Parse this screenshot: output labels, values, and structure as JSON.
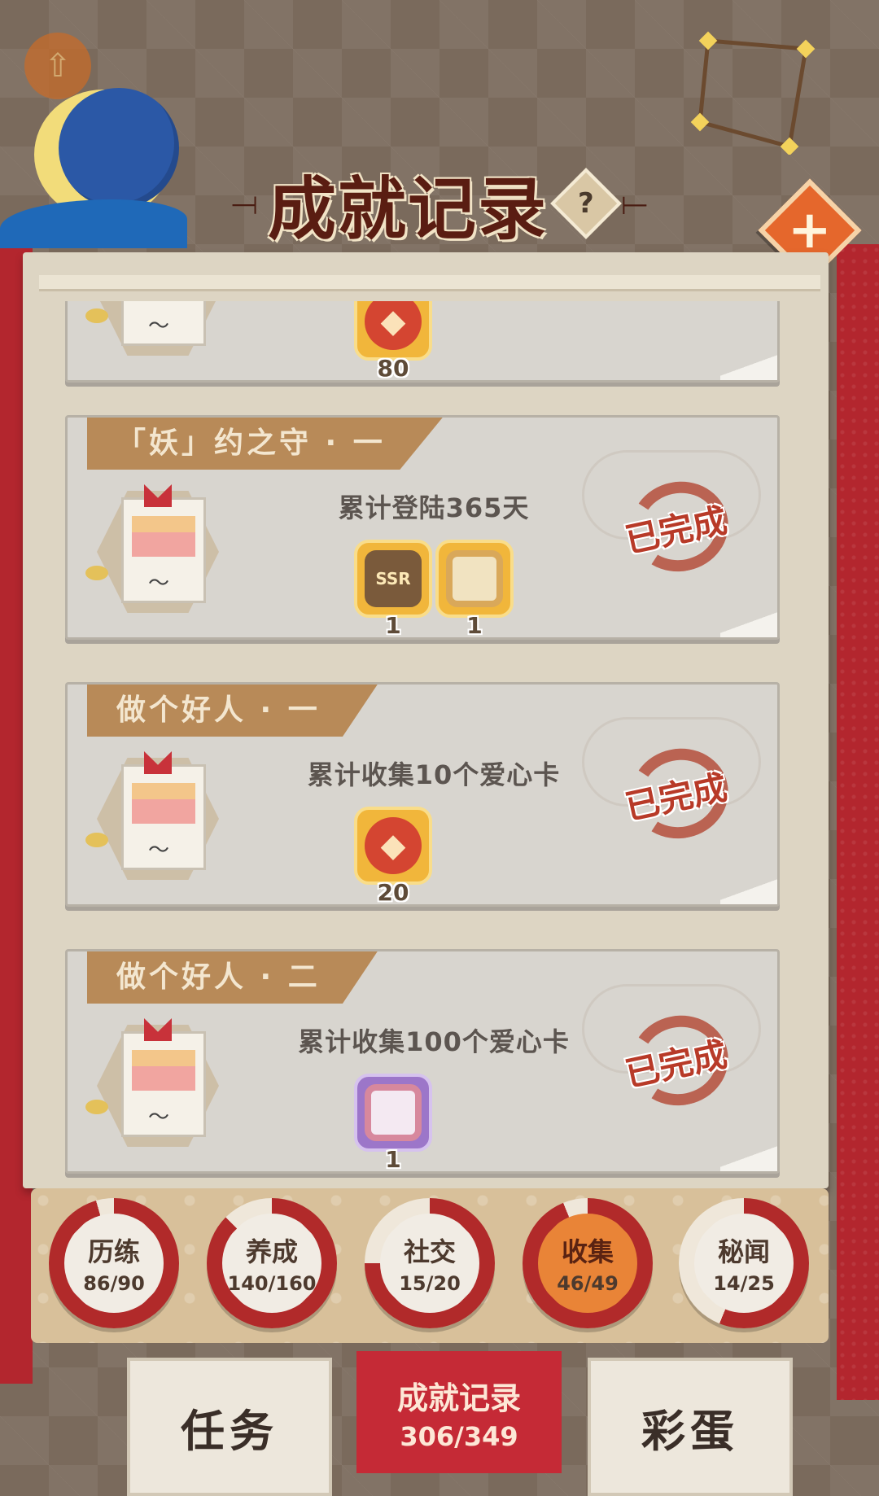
{
  "header": {
    "title": "成就记录",
    "help_label": "?",
    "close_label": "+"
  },
  "cards": [
    {
      "ribbon": "",
      "description": "",
      "rewards": [
        {
          "icon": "heart-coin-icon",
          "count": "80"
        }
      ],
      "completed_label": ""
    },
    {
      "ribbon": "「妖」约之守 · 一",
      "description": "累计登陆365天",
      "rewards": [
        {
          "icon": "ssr-shikigami-icon",
          "label": "SSR",
          "count": "1"
        },
        {
          "icon": "gold-avatar-frame-icon",
          "count": "1"
        }
      ],
      "completed_label": "已完成"
    },
    {
      "ribbon": "做个好人 · 一",
      "description": "累计收集10个爱心卡",
      "rewards": [
        {
          "icon": "heart-coin-icon",
          "count": "20"
        }
      ],
      "completed_label": "已完成"
    },
    {
      "ribbon": "做个好人 · 二",
      "description": "累计收集100个爱心卡",
      "rewards": [
        {
          "icon": "purple-avatar-frame-icon",
          "count": "1"
        }
      ],
      "completed_label": "已完成"
    }
  ],
  "categories": [
    {
      "name": "历练",
      "count": "86/90",
      "progress": 0.956
    },
    {
      "name": "养成",
      "count": "140/160",
      "progress": 0.875
    },
    {
      "name": "社交",
      "count": "15/20",
      "progress": 0.75
    },
    {
      "name": "收集",
      "count": "46/49",
      "progress": 0.939,
      "active": true
    },
    {
      "name": "秘闻",
      "count": "14/25",
      "progress": 0.56
    }
  ],
  "tabs": {
    "task": "任务",
    "achievement_title": "成就记录",
    "achievement_count": "306/349",
    "easter_egg": "彩蛋"
  },
  "colors": {
    "accent_red": "#c52a36",
    "stamp_red": "#b83a28",
    "ribbon_brown": "#b88a58",
    "active_orange": "#e98437"
  }
}
